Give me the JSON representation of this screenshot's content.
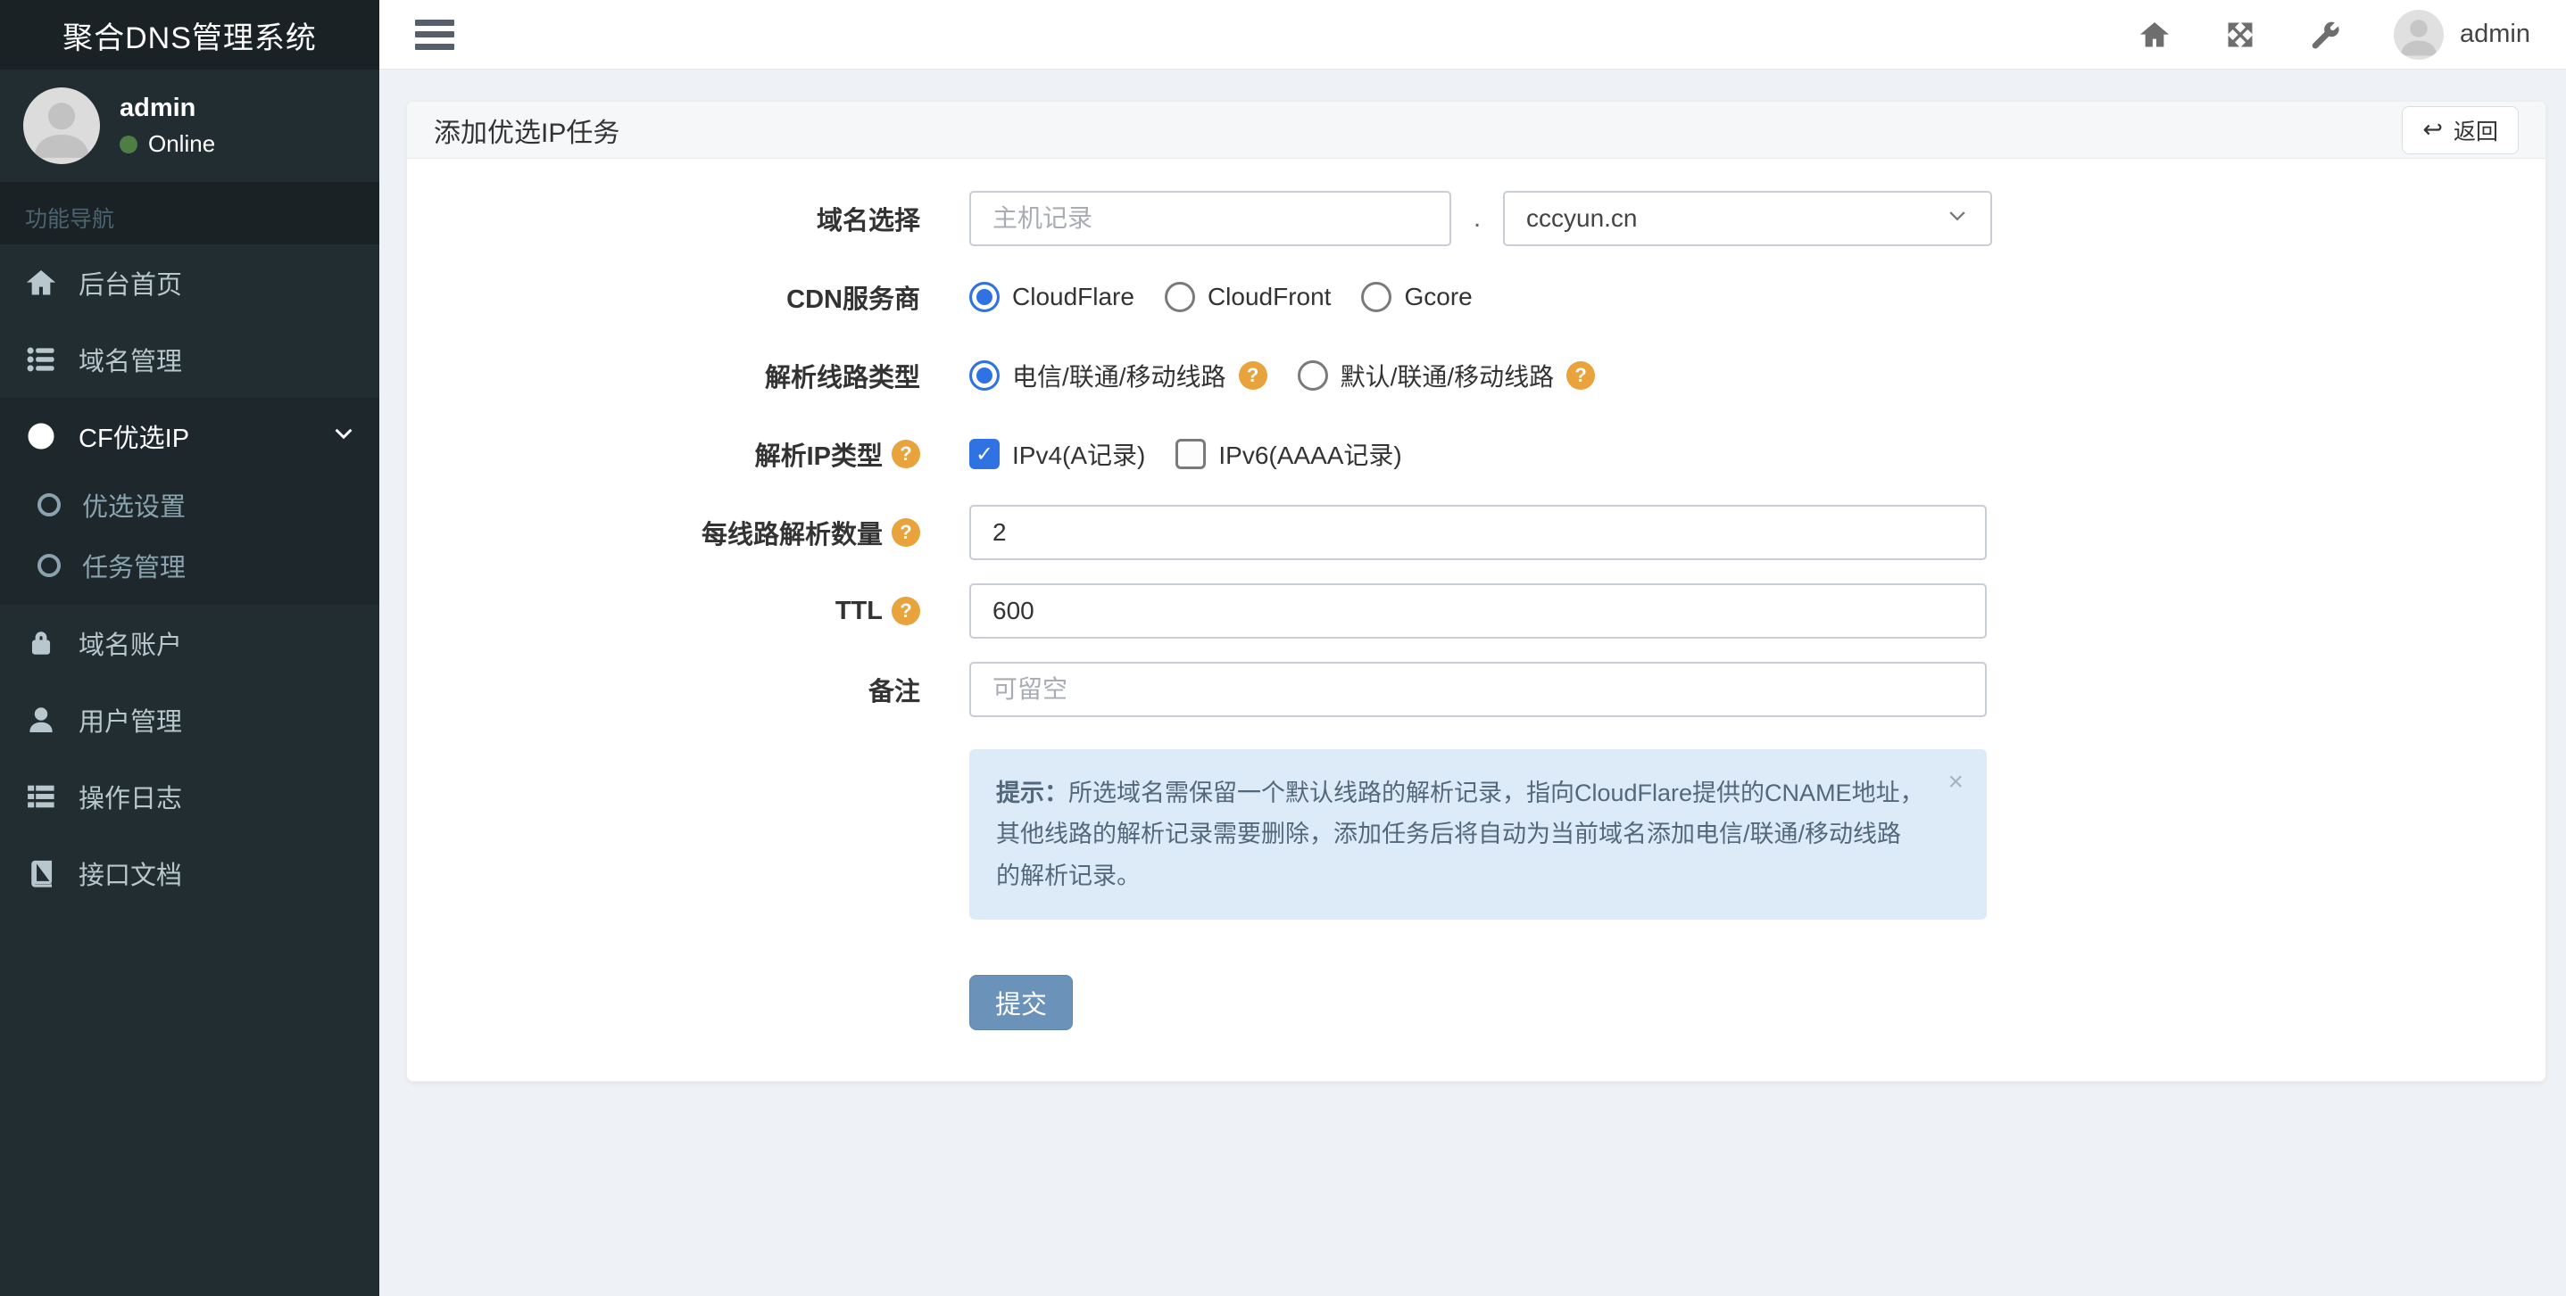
{
  "app": {
    "title": "聚合DNS管理系统"
  },
  "navbar": {
    "username": "admin"
  },
  "sidebar": {
    "user": {
      "name": "admin",
      "status": "Online"
    },
    "section_label": "功能导航",
    "items": [
      {
        "label": "后台首页",
        "icon": "home-icon"
      },
      {
        "label": "域名管理",
        "icon": "list-icon"
      },
      {
        "label": "CF优选IP",
        "icon": "globe-icon",
        "expanded": true
      },
      {
        "label": "优选设置",
        "icon": "circle-icon"
      },
      {
        "label": "任务管理",
        "icon": "circle-icon"
      },
      {
        "label": "域名账户",
        "icon": "lock-icon"
      },
      {
        "label": "用户管理",
        "icon": "user-icon"
      },
      {
        "label": "操作日志",
        "icon": "log-icon"
      },
      {
        "label": "接口文档",
        "icon": "book-icon"
      }
    ]
  },
  "page": {
    "card_title": "添加优选IP任务",
    "back_label": "返回"
  },
  "form": {
    "domain": {
      "label": "域名选择",
      "host_placeholder": "主机记录",
      "separator": ".",
      "selected_domain": "cccyun.cn"
    },
    "cdn": {
      "label": "CDN服务商",
      "options": [
        "CloudFlare",
        "CloudFront",
        "Gcore"
      ],
      "selected": "CloudFlare"
    },
    "line_type": {
      "label": "解析线路类型",
      "options": [
        "电信/联通/移动线路",
        "默认/联通/移动线路"
      ],
      "selected": "电信/联通/移动线路"
    },
    "ip_type": {
      "label": "解析IP类型",
      "options": [
        "IPv4(A记录)",
        "IPv6(AAAA记录)"
      ],
      "checked": [
        "IPv4(A记录)"
      ]
    },
    "per_line": {
      "label": "每线路解析数量",
      "value": "2"
    },
    "ttl": {
      "label": "TTL",
      "value": "600"
    },
    "remark": {
      "label": "备注",
      "placeholder": "可留空"
    },
    "hint": {
      "prefix": "提示：",
      "text": "所选域名需保留一个默认线路的解析记录，指向CloudFlare提供的CNAME地址，其他线路的解析记录需要删除，添加任务后将自动为当前域名添加电信/联通/移动线路的解析记录。",
      "close": "×"
    },
    "submit_label": "提交"
  },
  "icons": {
    "back_arrow": "↩",
    "check": "✓"
  },
  "colors": {
    "sidebar-bg": "#222d32",
    "sidebar-dark": "#1a2226",
    "sidebar-active": "#1e282c",
    "accent": "#2f72e4",
    "submit": "#6b92b8",
    "warning": "#e9a33c",
    "hint-bg": "#dcebf7",
    "hint-text": "#54687c",
    "online": "#4e7d45"
  }
}
